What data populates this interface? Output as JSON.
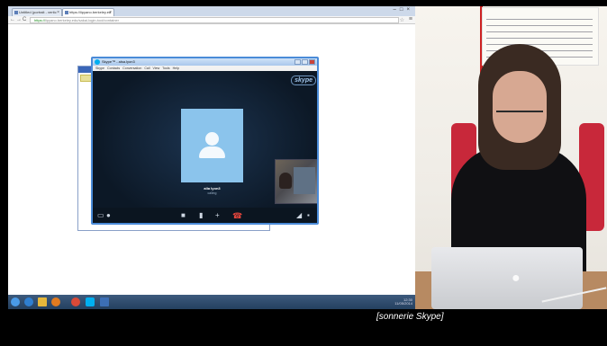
{
  "browser": {
    "tabs": [
      {
        "label": "Untitled (portrait - vertic"
      },
      {
        "label": "https://lipyano.berkeley.ed"
      }
    ],
    "address": {
      "scheme": "https://",
      "rest": "lipyano.berkeley.edu/sakai-login-tool/container"
    }
  },
  "skype": {
    "title": "Skype™ - alsa.lyon3",
    "menu": "Skype  Contacts  Conversation  Call  View  Tools  Help",
    "brand": "skype",
    "callee_name": "alia lyon3",
    "callee_status": "calling"
  },
  "taskbar": {
    "tray_time": "12:30",
    "tray_date": "11/05/2014"
  },
  "subtitle": "[sonnerie Skype]",
  "icons": {
    "skype_status": "skype-icon",
    "video": "video-icon",
    "mic": "mic-icon",
    "add": "plus-icon",
    "hangup": "phone-hangup-icon",
    "signal": "signal-icon",
    "fullscreen": "fullscreen-icon"
  }
}
